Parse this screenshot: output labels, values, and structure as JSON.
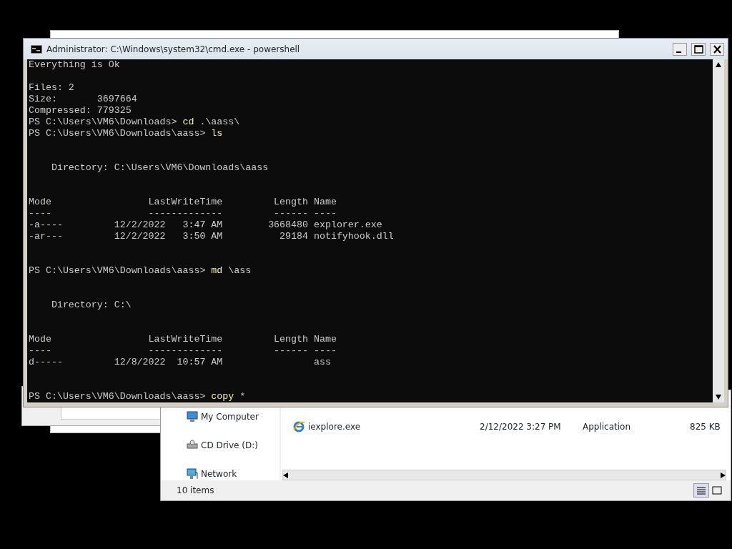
{
  "console_window": {
    "title": "Administrator: C:\\Windows\\system32\\cmd.exe - powershell",
    "lines": [
      {
        "kind": "output",
        "text": "Everything is Ok"
      },
      {
        "kind": "blank"
      },
      {
        "kind": "output",
        "text": "Files: 2"
      },
      {
        "kind": "output",
        "text": "Size:       3697664"
      },
      {
        "kind": "output",
        "text": "Compressed: 779325"
      },
      {
        "kind": "prompt",
        "text": "PS C:\\Users\\VM6\\Downloads> ",
        "command": "cd",
        "args": " .\\aass\\"
      },
      {
        "kind": "prompt",
        "text": "PS C:\\Users\\VM6\\Downloads\\aass> ",
        "command": "ls"
      },
      {
        "kind": "blank"
      },
      {
        "kind": "blank"
      },
      {
        "kind": "output",
        "text": "    Directory: C:\\Users\\VM6\\Downloads\\aass"
      },
      {
        "kind": "blank"
      },
      {
        "kind": "blank"
      },
      {
        "kind": "output",
        "text": "Mode                 LastWriteTime         Length Name"
      },
      {
        "kind": "output",
        "text": "----                 -------------         ------ ----"
      },
      {
        "kind": "output",
        "text": "-a----         12/2/2022   3:47 AM        3668480 explorer.exe"
      },
      {
        "kind": "output",
        "text": "-ar---         12/2/2022   3:50 AM          29184 notifyhook.dll"
      },
      {
        "kind": "blank"
      },
      {
        "kind": "blank"
      },
      {
        "kind": "prompt",
        "text": "PS C:\\Users\\VM6\\Downloads\\aass> ",
        "command": "md",
        "args": " \\ass"
      },
      {
        "kind": "blank"
      },
      {
        "kind": "blank"
      },
      {
        "kind": "output",
        "text": "    Directory: C:\\"
      },
      {
        "kind": "blank"
      },
      {
        "kind": "blank"
      },
      {
        "kind": "output",
        "text": "Mode                 LastWriteTime         Length Name"
      },
      {
        "kind": "output",
        "text": "----                 -------------         ------ ----"
      },
      {
        "kind": "output",
        "text": "d-----         12/8/2022  10:57 AM                ass"
      },
      {
        "kind": "blank"
      },
      {
        "kind": "blank"
      },
      {
        "kind": "prompt",
        "text": "PS C:\\Users\\VM6\\Downloads\\aass> ",
        "command": "copy",
        "args": " *"
      }
    ]
  },
  "explorer_window": {
    "sidebar": [
      {
        "label": "My Computer",
        "kind": "computer"
      },
      {
        "label": "CD Drive (D:)",
        "kind": "drive"
      },
      {
        "label": "Network",
        "kind": "network"
      }
    ],
    "files": [
      {
        "name": "iexplore.exe",
        "modified": "2/12/2022 3:27 PM",
        "type": "Application",
        "size": "825 KB"
      }
    ],
    "status": "10 items",
    "views": [
      {
        "kind": "details",
        "selected": true
      },
      {
        "kind": "icons",
        "selected": false
      }
    ]
  }
}
